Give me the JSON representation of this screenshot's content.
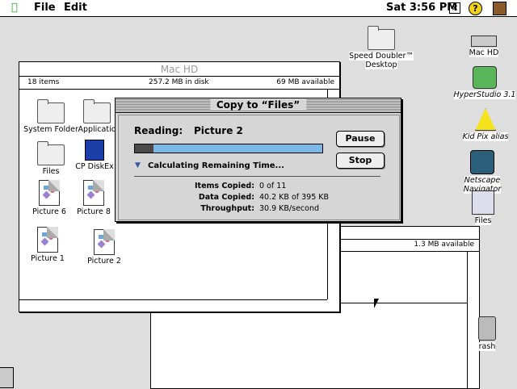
{
  "menubar": {
    "apple": "",
    "file": "File",
    "edit": "Edit",
    "clock": "Sat 3:56 PM"
  },
  "machd_window": {
    "title": "Mac HD",
    "items": "18 items",
    "disk": "257.2 MB in disk",
    "available": "69 MB available",
    "icons": [
      {
        "label": "System Folder"
      },
      {
        "label": "Applicatio"
      },
      {
        "label": "Files"
      },
      {
        "label": "CP DiskEx"
      },
      {
        "label": "Picture 6"
      },
      {
        "label": "Picture 8"
      },
      {
        "label": "Picture 1"
      },
      {
        "label": "Picture 2"
      }
    ]
  },
  "files_window": {
    "available": "1.3 MB available"
  },
  "dialog": {
    "title": "Copy to “Files”",
    "reading_label": "Reading:",
    "reading_value": "Picture 2",
    "progress": 0.1,
    "pause": "Pause",
    "stop": "Stop",
    "calc": "Calculating Remaining Time...",
    "items_label": "Items Copied:",
    "items_value": "0 of 11",
    "data_label": "Data Copied:",
    "data_value": "40.2 KB of 395 KB",
    "through_label": "Throughput:",
    "through_value": "30.9 KB/second"
  },
  "desktop": {
    "speed_doubler": "Speed Doubler™ Desktop",
    "mac_hd": "Mac HD",
    "hyperstudio": "HyperStudio 3.1",
    "kidpix": "Kid Pix alias",
    "netscape": "Netscape Navigator",
    "files": "Files",
    "trash": "rash"
  }
}
